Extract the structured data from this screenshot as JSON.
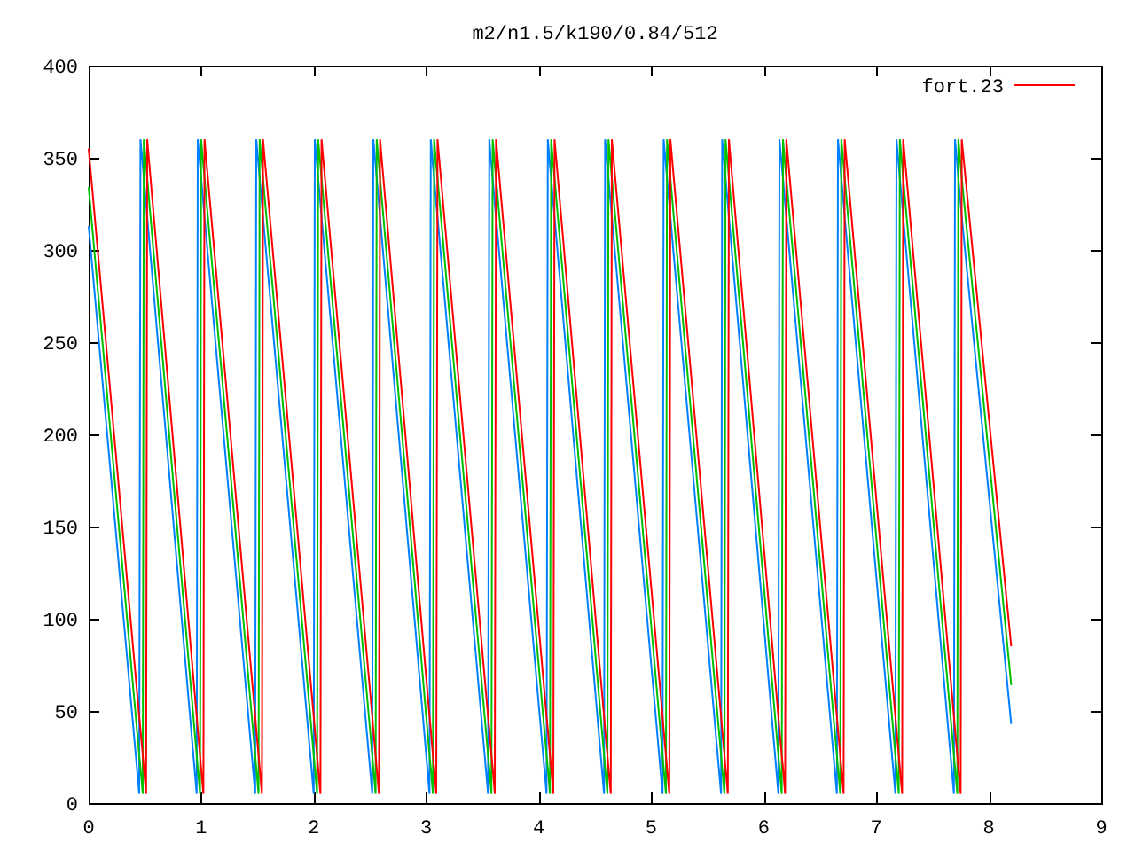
{
  "chart_data": {
    "type": "line",
    "title": "m2/n1.5/k190/0.84/512",
    "xlim": [
      0,
      9
    ],
    "ylim": [
      0,
      400
    ],
    "xticks": [
      0,
      1,
      2,
      3,
      4,
      5,
      6,
      7,
      8,
      9
    ],
    "yticks": [
      0,
      50,
      100,
      150,
      200,
      250,
      300,
      350,
      400
    ],
    "x": [
      0,
      0.45,
      0.46,
      0.48,
      0.49,
      0.51,
      0.52,
      0.96,
      0.97,
      0.99,
      1.0,
      1.02,
      1.03,
      1.48,
      1.49,
      1.51,
      1.52,
      1.54,
      1.55,
      2.0,
      2.01,
      2.03,
      2.04,
      2.06,
      2.07,
      2.52,
      2.53,
      2.55,
      2.56,
      2.58,
      2.59,
      3.03,
      3.04,
      3.06,
      3.07,
      3.09,
      3.1,
      3.55,
      3.56,
      3.58,
      3.59,
      3.61,
      3.62,
      4.07,
      4.08,
      4.1,
      4.11,
      4.13,
      4.14,
      4.58,
      4.59,
      4.61,
      4.62,
      4.64,
      4.65,
      5.1,
      5.11,
      5.13,
      5.14,
      5.16,
      5.17,
      5.62,
      5.63,
      5.65,
      5.66,
      5.68,
      5.69,
      6.13,
      6.14,
      6.16,
      6.17,
      6.19,
      6.2,
      6.65,
      6.66,
      6.68,
      6.69,
      6.71,
      6.72,
      7.17,
      7.18,
      7.2,
      7.21,
      7.23,
      7.24,
      7.69,
      7.7,
      7.72,
      7.73,
      7.75,
      7.76,
      8.2
    ],
    "series": [
      {
        "name": "fort.23",
        "color": "#ff0000",
        "values": [
          355,
          47,
          40,
          26,
          19,
          5,
          360,
          47,
          40,
          26,
          19,
          5,
          360,
          47,
          40,
          26,
          19,
          5,
          360,
          47,
          40,
          26,
          19,
          5,
          360,
          47,
          40,
          26,
          19,
          5,
          360,
          47,
          40,
          26,
          19,
          5,
          360,
          47,
          40,
          26,
          19,
          5,
          360,
          47,
          40,
          26,
          19,
          5,
          360,
          47,
          40,
          26,
          19,
          5,
          360,
          47,
          40,
          26,
          19,
          5,
          360,
          47,
          40,
          26,
          19,
          5,
          360,
          47,
          40,
          26,
          19,
          5,
          360,
          47,
          40,
          26,
          19,
          5,
          360,
          47,
          40,
          26,
          19,
          5,
          360,
          47,
          40,
          26,
          19,
          5,
          360,
          85
        ]
      },
      {
        "color": "#00c000",
        "values": [
          334,
          26,
          19,
          5,
          360,
          346,
          339,
          26,
          19,
          5,
          360,
          346,
          339,
          26,
          19,
          5,
          360,
          346,
          339,
          26,
          19,
          5,
          360,
          346,
          339,
          26,
          19,
          5,
          360,
          346,
          339,
          26,
          19,
          5,
          360,
          346,
          339,
          26,
          19,
          5,
          360,
          346,
          339,
          26,
          19,
          5,
          360,
          346,
          339,
          26,
          19,
          5,
          360,
          346,
          339,
          26,
          19,
          5,
          360,
          346,
          339,
          26,
          19,
          5,
          360,
          346,
          339,
          26,
          19,
          5,
          360,
          346,
          339,
          26,
          19,
          5,
          360,
          346,
          339,
          26,
          19,
          5,
          360,
          346,
          339,
          26,
          19,
          5,
          360,
          346,
          339,
          64
        ]
      },
      {
        "color": "#0080ff",
        "values": [
          313,
          5,
          360,
          346,
          339,
          325,
          318,
          5,
          360,
          346,
          339,
          325,
          318,
          5,
          360,
          346,
          339,
          325,
          318,
          5,
          360,
          346,
          339,
          325,
          318,
          5,
          360,
          346,
          339,
          325,
          318,
          5,
          360,
          346,
          339,
          325,
          318,
          5,
          360,
          346,
          339,
          325,
          318,
          5,
          360,
          346,
          339,
          325,
          318,
          5,
          360,
          346,
          339,
          325,
          318,
          5,
          360,
          346,
          339,
          325,
          318,
          5,
          360,
          346,
          339,
          325,
          318,
          5,
          360,
          346,
          339,
          325,
          318,
          5,
          360,
          346,
          339,
          325,
          318,
          5,
          360,
          346,
          339,
          325,
          318,
          5,
          360,
          346,
          339,
          325,
          318,
          43
        ]
      }
    ]
  }
}
